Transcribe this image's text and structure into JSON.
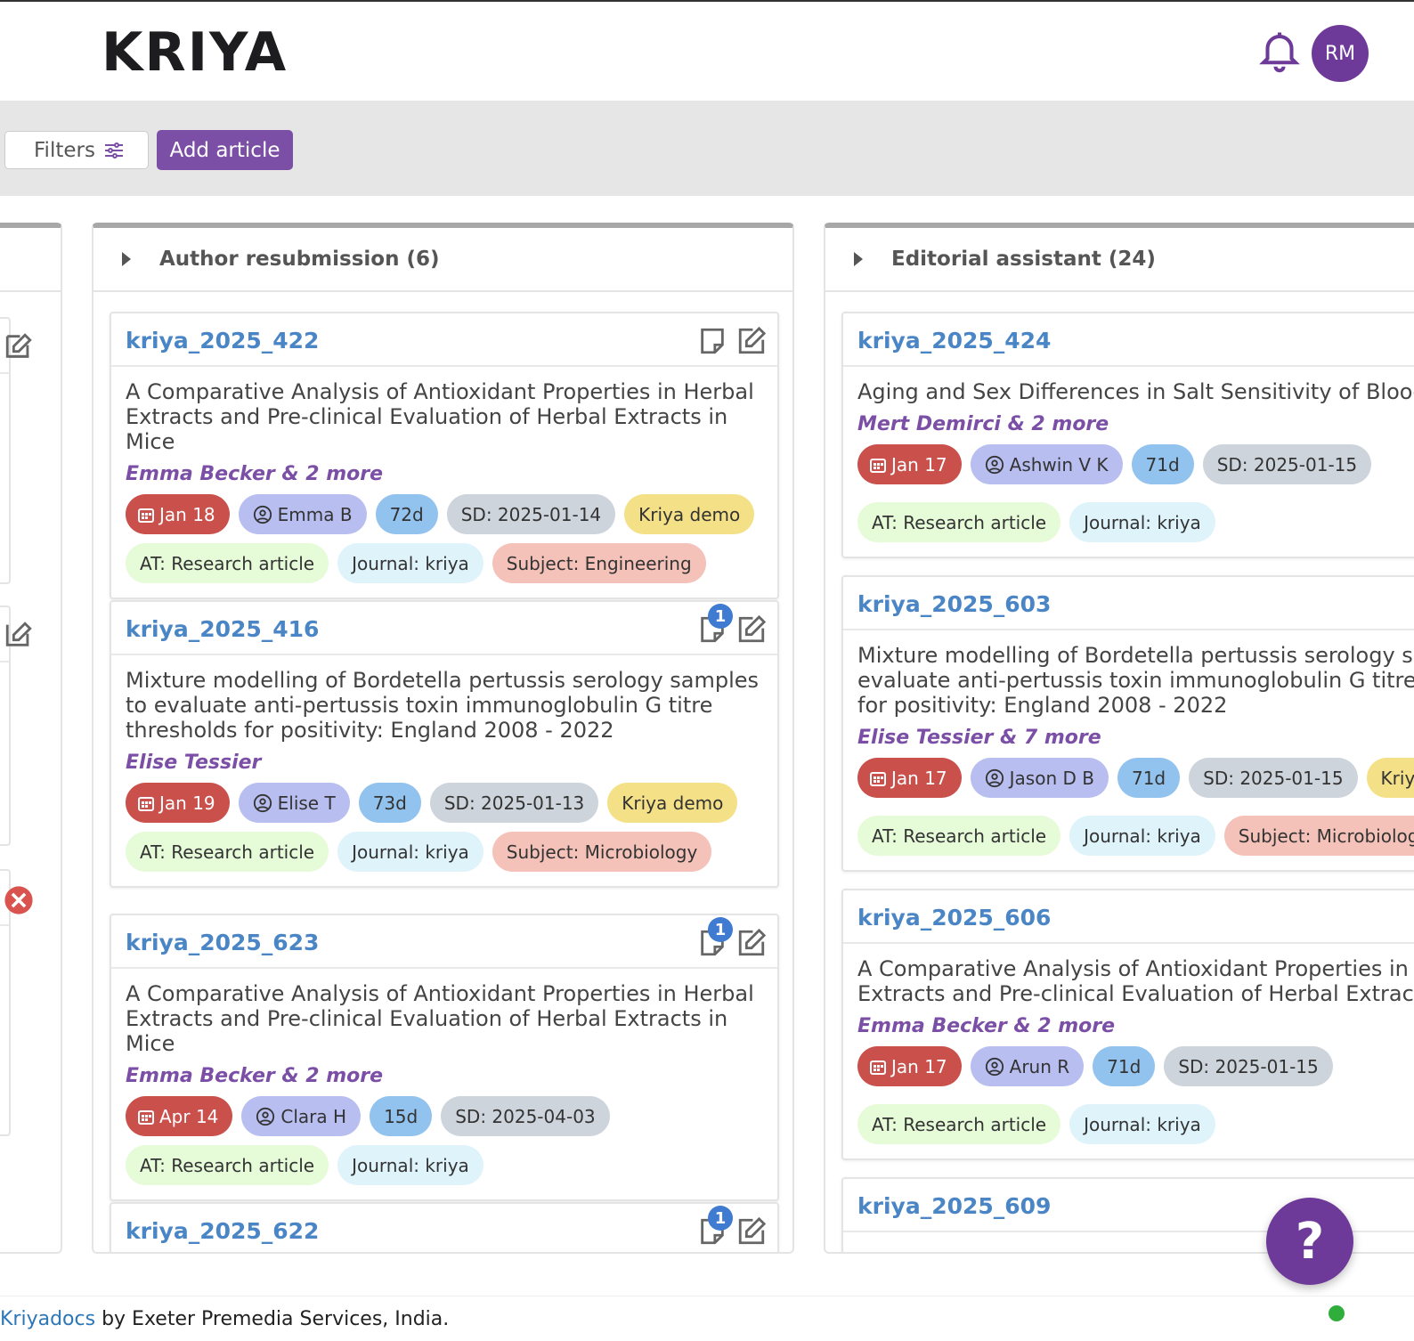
{
  "app": {
    "logo": "KRIYA",
    "avatar_initials": "RM"
  },
  "toolbar": {
    "filters_label": "Filters",
    "add_article_label": "Add article"
  },
  "columns": [
    {
      "title": "Author resubmission (6)",
      "cards": [
        {
          "id": "kriya_2025_422",
          "title": "A Comparative Analysis of Antioxidant Properties in Herbal Extracts and Pre-clinical Evaluation of Herbal Extracts in Mice",
          "authors": "Emma Becker & 2 more",
          "note_badge": "",
          "chips": {
            "date": "Jan 18",
            "user": "Emma B",
            "days": "72d",
            "sd": "SD: 2025-01-14",
            "demo": "Kriya demo",
            "at": "AT: Research article",
            "journal": "Journal: kriya",
            "subject": "Subject: Engineering"
          }
        },
        {
          "id": "kriya_2025_416",
          "title": "Mixture modelling of Bordetella pertussis serology samples to evaluate anti-pertussis toxin immunoglobulin G titre thresholds for positivity: England 2008 - 2022",
          "authors": "Elise Tessier",
          "note_badge": "1",
          "chips": {
            "date": "Jan 19",
            "user": "Elise T",
            "days": "73d",
            "sd": "SD: 2025-01-13",
            "demo": "Kriya demo",
            "at": "AT: Research article",
            "journal": "Journal: kriya",
            "subject": "Subject: Microbiology"
          }
        },
        {
          "id": "kriya_2025_623",
          "title": "A Comparative Analysis of Antioxidant Properties in Herbal Extracts and Pre-clinical Evaluation of Herbal Extracts in Mice",
          "authors": "Emma Becker & 2 more",
          "note_badge": "1",
          "chips": {
            "date": "Apr 14",
            "user": "Clara H",
            "days": "15d",
            "sd": "SD: 2025-04-03",
            "at": "AT: Research article",
            "journal": "Journal: kriya"
          }
        },
        {
          "id": "kriya_2025_622",
          "note_badge": "1"
        }
      ]
    },
    {
      "title": "Editorial assistant (24)",
      "cards": [
        {
          "id": "kriya_2025_424",
          "title": "Aging and Sex Differences in Salt Sensitivity of Blood P",
          "authors": "Mert Demirci & 2 more",
          "chips": {
            "date": "Jan 17",
            "user": "Ashwin V K",
            "days": "71d",
            "sd": "SD: 2025-01-15",
            "at": "AT: Research article",
            "journal": "Journal: kriya"
          }
        },
        {
          "id": "kriya_2025_603",
          "title": "Mixture modelling of Bordetella pertussis serology sar evaluate anti-pertussis toxin immunoglobulin G titre t for positivity: England 2008 - 2022",
          "title_lines": [
            "Mixture modelling of Bordetella pertussis serology sar",
            "evaluate anti-pertussis toxin immunoglobulin G titre t",
            "for positivity: England 2008 - 2022"
          ],
          "authors": "Elise Tessier & 7 more",
          "chips": {
            "date": "Jan 17",
            "user": "Jason D B",
            "days": "71d",
            "sd": "SD: 2025-01-15",
            "demo": "Kriya",
            "at": "AT: Research article",
            "journal": "Journal: kriya",
            "subject": "Subject: Microbiology"
          }
        },
        {
          "id": "kriya_2025_606",
          "title_lines": [
            "A Comparative Analysis of Antioxidant Properties in He",
            "Extracts and Pre-clinical Evaluation of Herbal Extracts"
          ],
          "authors": "Emma Becker & 2 more",
          "chips": {
            "date": "Jan 17",
            "user": "Arun R",
            "days": "71d",
            "sd": "SD: 2025-01-15",
            "at": "AT: Research article",
            "journal": "Journal: kriya"
          }
        },
        {
          "id": "kriya_2025_609"
        }
      ]
    }
  ],
  "help_label": "?",
  "footer": {
    "link": "Kriyadocs",
    "text": " by Exeter Premedia Services, India."
  }
}
